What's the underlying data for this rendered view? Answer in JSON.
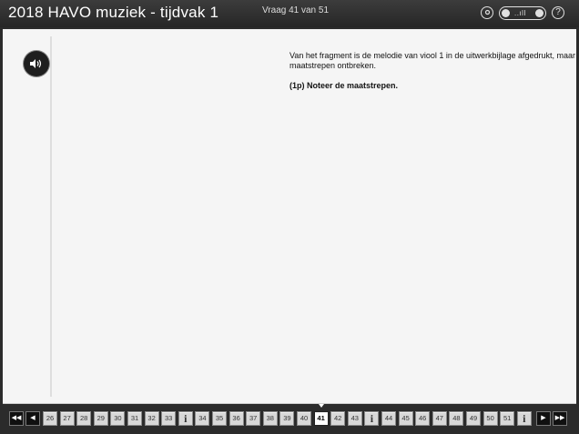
{
  "header": {
    "title": "2018 HAVO muziek - tijdvak 1",
    "counter": "Vraag 41 van 51",
    "volume_bars": "..ıll",
    "help_glyph": "?"
  },
  "question": {
    "text": "Van het fragment is de melodie van viool 1 in de uitwerkbijlage afgedrukt, maar maatstrepen ontbreken.",
    "task": "(1p) Noteer de maatstrepen."
  },
  "nav": {
    "first_glyph": "◀◀",
    "prev_glyph": "◀",
    "next_glyph": "▶",
    "last_glyph": "▶▶",
    "current": "41",
    "items": [
      "26",
      "27",
      "28",
      "29",
      "30",
      "31",
      "32",
      "33",
      "i",
      "34",
      "35",
      "36",
      "37",
      "38",
      "39",
      "40",
      "41",
      "42",
      "43",
      "i",
      "44",
      "45",
      "46",
      "47",
      "48",
      "49",
      "50",
      "51",
      "i"
    ]
  }
}
